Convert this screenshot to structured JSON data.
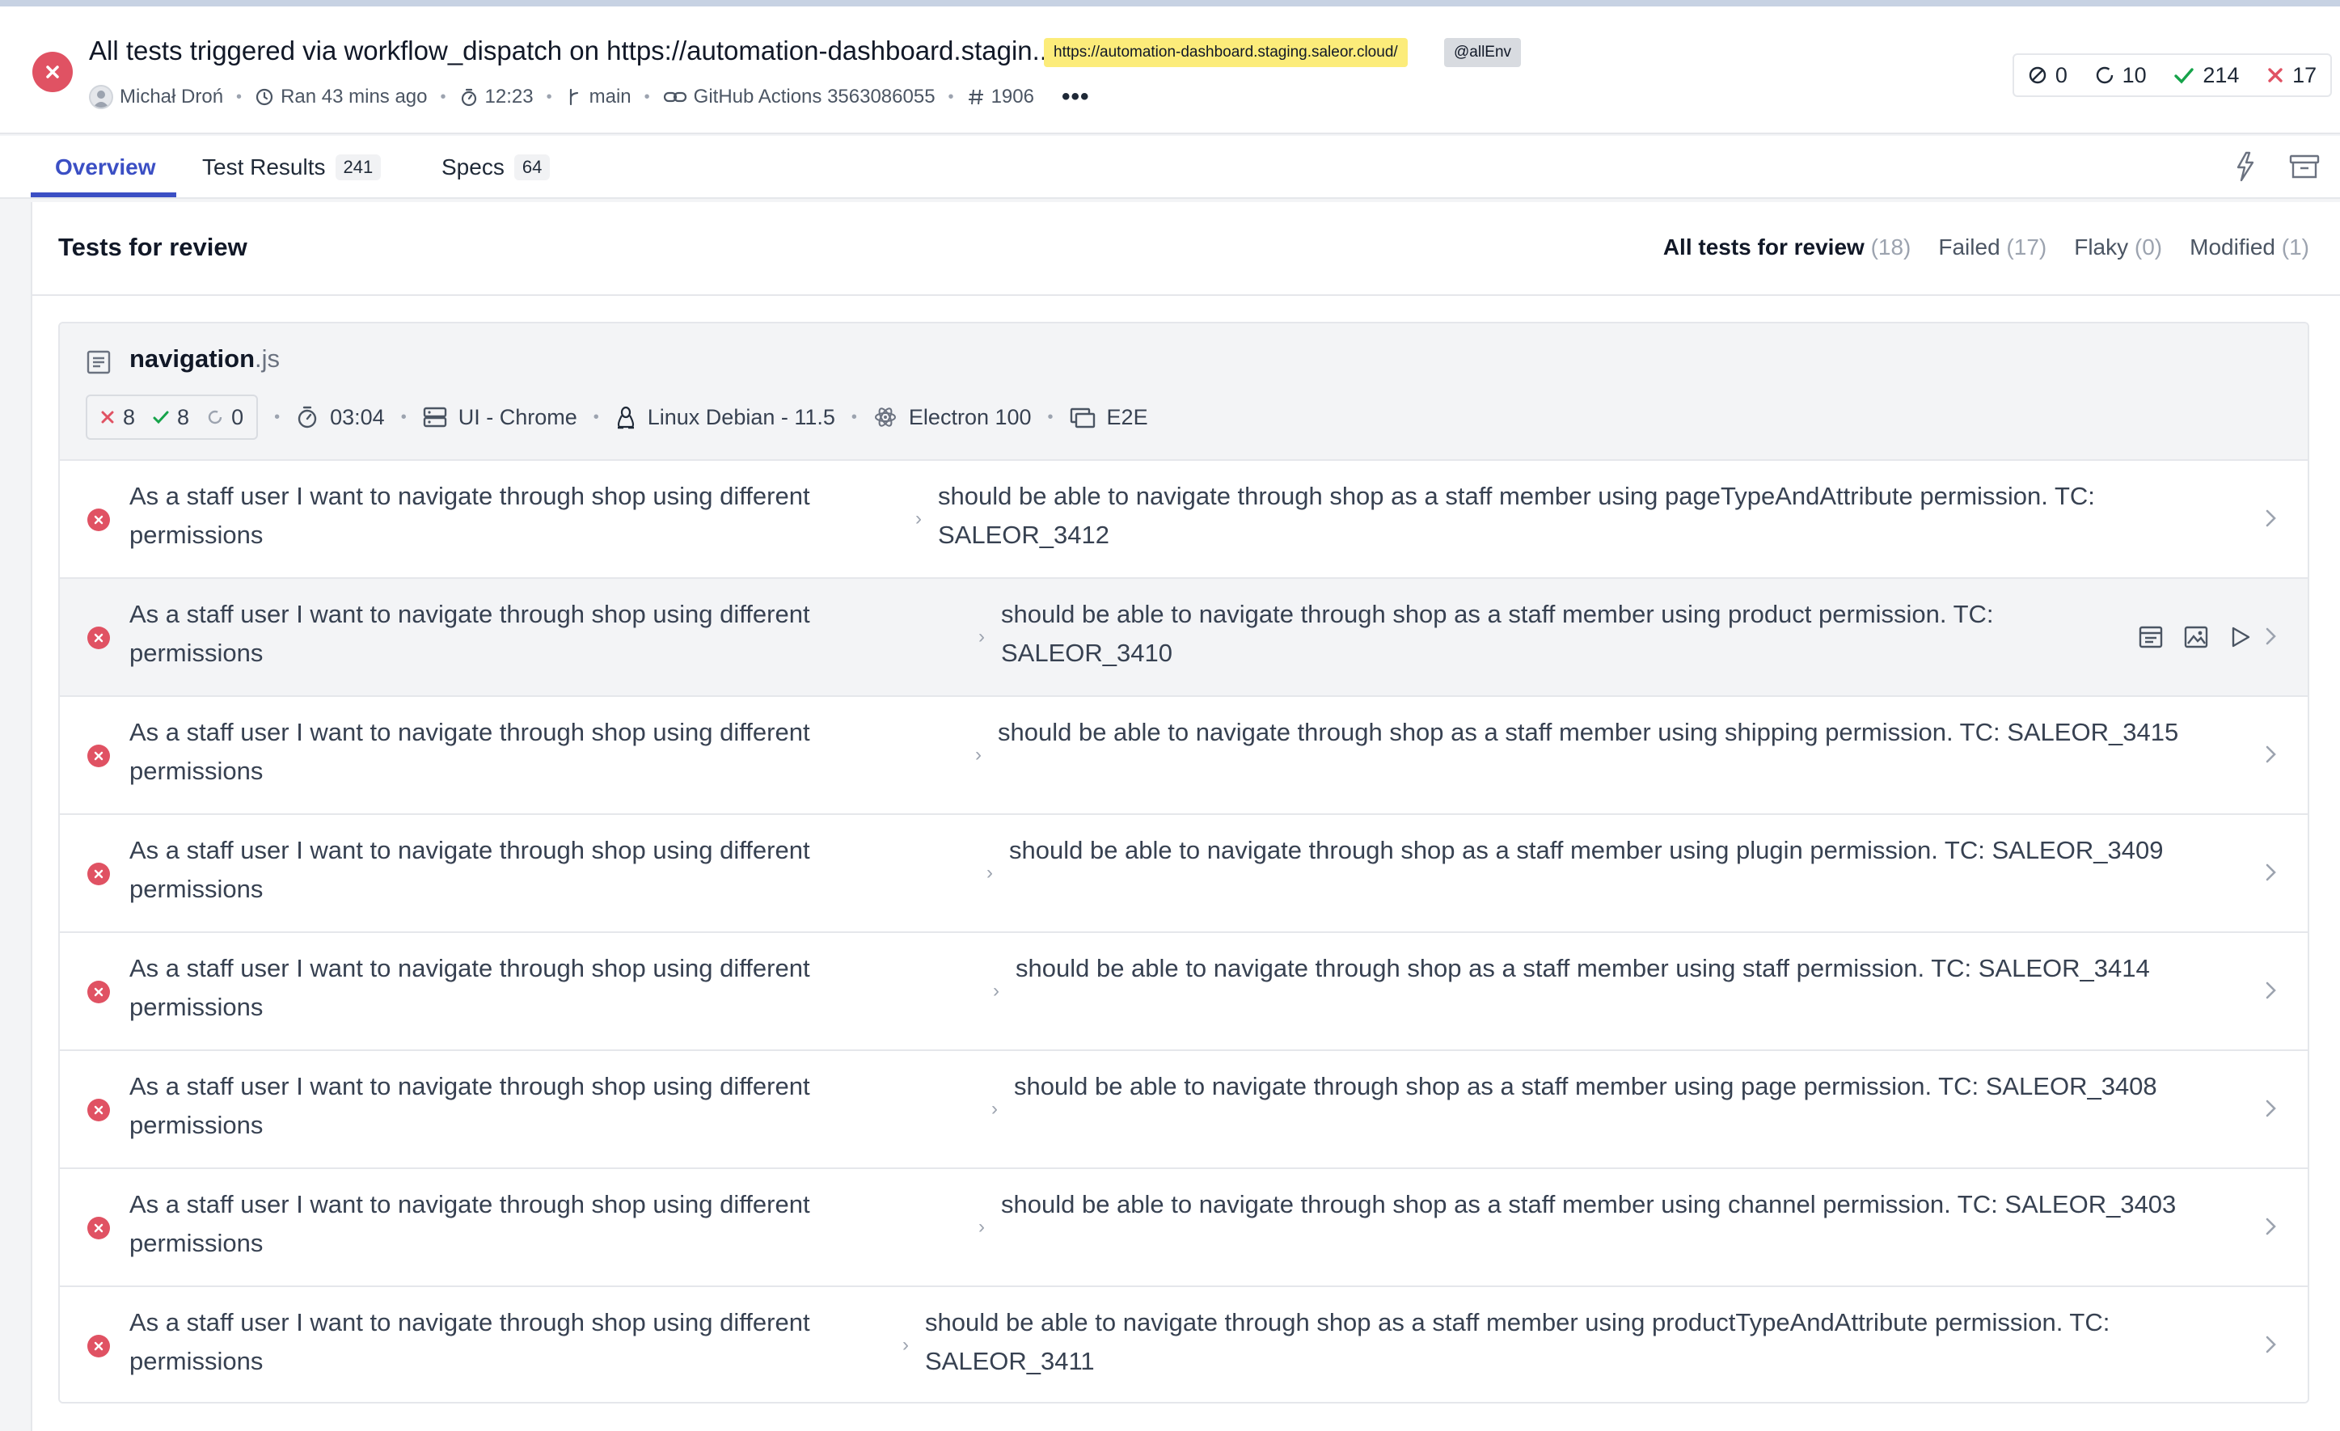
{
  "header": {
    "title": "All tests triggered via workflow_dispatch on https://automation-dashboard.stagin...",
    "tag_url": "https://automation-dashboard.staging.saleor.cloud/",
    "tag_env": "@allEnv",
    "meta": {
      "author": "Michał Droń",
      "ran": "Ran 43 mins ago",
      "duration": "12:23",
      "branch": "main",
      "ci": "GitHub Actions 3563086055",
      "run_number": "1906"
    },
    "counts": {
      "skipped": "0",
      "pending": "10",
      "passed": "214",
      "failed": "17"
    }
  },
  "tabs": [
    {
      "label": "Overview"
    },
    {
      "label": "Test Results",
      "badge": "241"
    },
    {
      "label": "Specs",
      "badge": "64"
    }
  ],
  "review": {
    "title": "Tests for review",
    "filters": [
      {
        "label": "All tests for review",
        "count": "(18)"
      },
      {
        "label": "Failed",
        "count": "(17)"
      },
      {
        "label": "Flaky",
        "count": "(0)"
      },
      {
        "label": "Modified",
        "count": "(1)"
      }
    ]
  },
  "spec": {
    "name": "navigation",
    "ext": ".js",
    "failed": "8",
    "passed": "8",
    "pending": "0",
    "duration": "03:04",
    "browser": "UI - Chrome",
    "os": "Linux Debian - 11.5",
    "runner": "Electron 100",
    "type": "E2E"
  },
  "rows": [
    {
      "suite": "As a staff user I want to navigate through shop using different permissions",
      "test": "should be able to navigate through shop as a staff member using pageTypeAndAttribute permission. TC: SALEOR_3412"
    },
    {
      "suite": "As a staff user I want to navigate through shop using different permissions",
      "test": "should be able to navigate through shop as a staff member using product permission. TC: SALEOR_3410"
    },
    {
      "suite": "As a staff user I want to navigate through shop using different permissions",
      "test": "should be able to navigate through shop as a staff member using shipping permission. TC: SALEOR_3415"
    },
    {
      "suite": "As a staff user I want to navigate through shop using different permissions",
      "test": "should be able to navigate through shop as a staff member using plugin permission. TC: SALEOR_3409"
    },
    {
      "suite": "As a staff user I want to navigate through shop using different permissions",
      "test": "should be able to navigate through shop as a staff member using staff permission. TC: SALEOR_3414"
    },
    {
      "suite": "As a staff user I want to navigate through shop using different permissions",
      "test": "should be able to navigate through shop as a staff member using page permission. TC: SALEOR_3408"
    },
    {
      "suite": "As a staff user I want to navigate through shop using different permissions",
      "test": "should be able to navigate through shop as a staff member using channel permission. TC: SALEOR_3403"
    },
    {
      "suite": "As a staff user I want to navigate through shop using different permissions",
      "test": "should be able to navigate through shop as a staff member using productTypeAndAttribute permission. TC: SALEOR_3411"
    }
  ],
  "colors": {
    "accent": "#3b4fc4",
    "fail": "#e05263",
    "pass": "#16a34a",
    "tag_yellow": "#fcec7a"
  }
}
